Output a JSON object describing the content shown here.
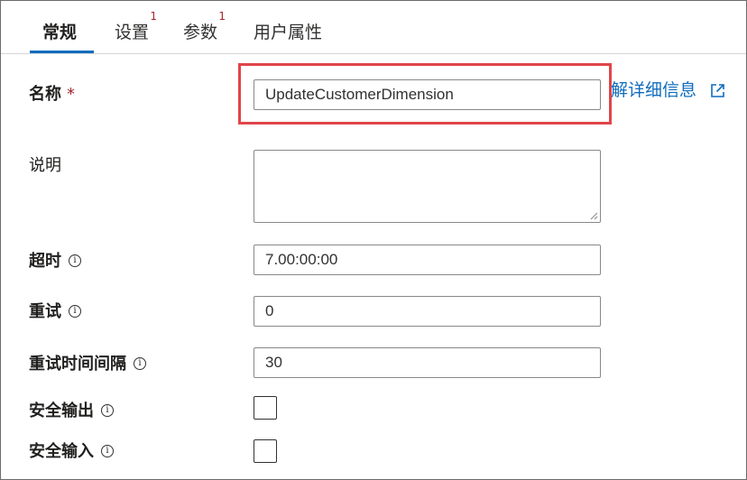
{
  "tabs": [
    {
      "label": "常规",
      "badge": ""
    },
    {
      "label": "设置",
      "badge": "1"
    },
    {
      "label": "参数",
      "badge": "1"
    },
    {
      "label": "用户属性",
      "badge": ""
    }
  ],
  "form": {
    "name": {
      "label": "名称",
      "required_mark": "*",
      "value": "UpdateCustomerDimension"
    },
    "learn_more": "解详细信息",
    "description": {
      "label": "说明",
      "value": ""
    },
    "timeout": {
      "label": "超时",
      "value": "7.00:00:00"
    },
    "retry": {
      "label": "重试",
      "value": "0"
    },
    "retry_interval": {
      "label": "重试时间间隔",
      "value": "30"
    },
    "secure_output": {
      "label": "安全输出",
      "checked": false
    },
    "secure_input": {
      "label": "安全输入",
      "checked": false
    }
  },
  "icons": {
    "info": "info-icon",
    "external_link": "external-link-icon"
  },
  "colors": {
    "accent": "#0f6cbd",
    "required": "#a4262c",
    "highlight": "#e0454a"
  }
}
